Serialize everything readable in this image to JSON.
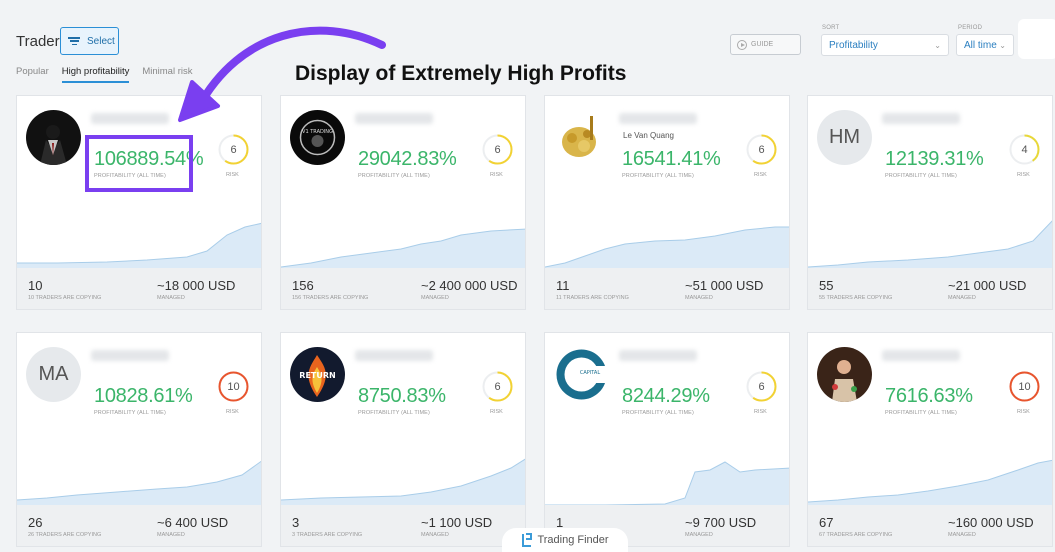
{
  "header": {
    "title": "Traders",
    "select_label": "Select",
    "tabs": [
      "Popular",
      "High profitability",
      "Minimal risk"
    ],
    "active_tab": "High profitability",
    "guide_label": "GUIDE",
    "sort": {
      "label": "SORT",
      "value": "Profitability"
    },
    "period": {
      "label": "PERIOD",
      "value": "All time"
    }
  },
  "annotation": "Display of Extremely High Profits",
  "labels": {
    "profitability": "PROFITABILITY (ALL TIME)",
    "risk": "RISK",
    "managed": "MANAGED"
  },
  "cards": [
    {
      "avatar": "suit-photo",
      "initials": "",
      "subname": "",
      "profit": "106889.54%",
      "risk": "6",
      "risk_color": "#f2d233",
      "risk_level": 0.6,
      "copiers": "10",
      "copiers_label": "10 TRADERS ARE COPYING",
      "managed": "~18 000 USD"
    },
    {
      "avatar": "v1-logo",
      "initials": "",
      "subname": "",
      "profit": "29042.83%",
      "risk": "6",
      "risk_color": "#f2d233",
      "risk_level": 0.6,
      "copiers": "156",
      "copiers_label": "156 TRADERS ARE COPYING",
      "managed": "~2 400 000 USD"
    },
    {
      "avatar": "gold-coins",
      "initials": "",
      "subname": "Le Van Quang",
      "profit": "16541.41%",
      "risk": "6",
      "risk_color": "#f2d233",
      "risk_level": 0.6,
      "copiers": "11",
      "copiers_label": "11 TRADERS ARE COPYING",
      "managed": "~51 000 USD"
    },
    {
      "avatar": "initials",
      "initials": "HM",
      "subname": "",
      "profit": "12139.31%",
      "risk": "4",
      "risk_color": "#e8d838",
      "risk_level": 0.4,
      "copiers": "55",
      "copiers_label": "55 TRADERS ARE COPYING",
      "managed": "~21 000 USD"
    },
    {
      "avatar": "initials",
      "initials": "MA",
      "subname": "",
      "profit": "10828.61%",
      "risk": "10",
      "risk_color": "#e8552e",
      "risk_level": 1.0,
      "copiers": "26",
      "copiers_label": "26 TRADERS ARE COPYING",
      "managed": "~6 400 USD"
    },
    {
      "avatar": "return-fire",
      "initials": "",
      "subname": "",
      "profit": "8750.83%",
      "risk": "6",
      "risk_color": "#f2d233",
      "risk_level": 0.6,
      "copiers": "3",
      "copiers_label": "3 TRADERS ARE COPYING",
      "managed": "~1 100 USD"
    },
    {
      "avatar": "capital-logo",
      "initials": "",
      "subname": "",
      "profit": "8244.29%",
      "risk": "6",
      "risk_color": "#f2d233",
      "risk_level": 0.6,
      "copiers": "1",
      "copiers_label": "",
      "managed": "~9 700 USD"
    },
    {
      "avatar": "figure-photo",
      "initials": "",
      "subname": "",
      "profit": "7616.63%",
      "risk": "10",
      "risk_color": "#e8552e",
      "risk_level": 1.0,
      "copiers": "67",
      "copiers_label": "67 TRADERS ARE COPYING",
      "managed": "~160 000 USD"
    }
  ],
  "watermark": "Trading Finder"
}
